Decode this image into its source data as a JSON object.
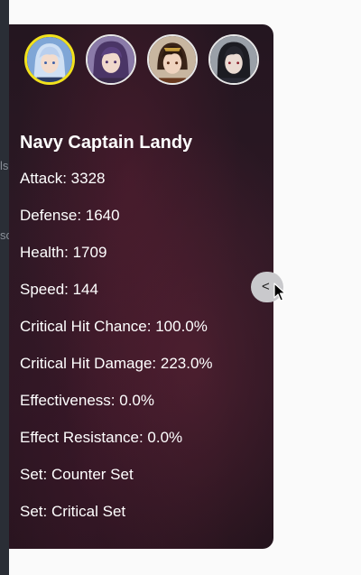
{
  "background_fragments": [
    "ls",
    "so"
  ],
  "team": {
    "avatars": [
      {
        "name": "Navy Captain Landy",
        "selected": true
      },
      {
        "name": "hero-2",
        "selected": false
      },
      {
        "name": "hero-3",
        "selected": false
      },
      {
        "name": "hero-4",
        "selected": false
      }
    ]
  },
  "hero": {
    "name": "Navy Captain Landy",
    "stats": [
      "Attack: 3328",
      "Defense: 1640",
      "Health: 1709",
      "Speed: 144",
      "Critical Hit Chance: 100.0%",
      "Critical Hit Damage: 223.0%",
      "Effectiveness: 0.0%",
      "Effect Resistance: 0.0%",
      "Set: Counter Set",
      "Set: Critical Set"
    ]
  },
  "panel_toggle": {
    "label": "<"
  },
  "colors": {
    "selected_border": "#f2e21c",
    "panel_bg": "#2a1622",
    "text": "#ffffff"
  }
}
